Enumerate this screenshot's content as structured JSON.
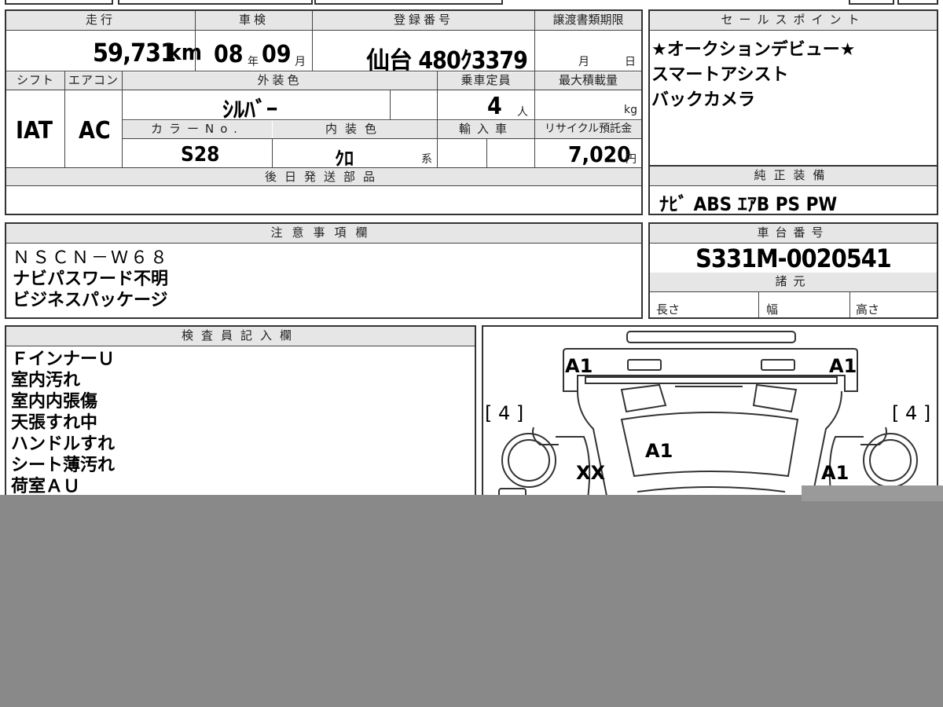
{
  "headers": {
    "mileage": "走行",
    "inspection": "車検",
    "registration": "登録番号",
    "transfer_deadline": "譲渡書類期限",
    "sales_points": "セールスポイント",
    "shift": "シフト",
    "aircon": "エアコン",
    "exterior_color": "外装色",
    "capacity": "乗車定員",
    "max_load": "最大積載量",
    "color_no": "カラーNo.",
    "interior_color": "内装色",
    "import": "輸入車",
    "recycle": "リサイクル預託金",
    "later_parts": "後日発送部品",
    "genuine_equipment": "純正装備",
    "notes": "注意事項欄",
    "chassis_no": "車台番号",
    "specs": "諸元",
    "inspector": "検査員記入欄"
  },
  "vehicle": {
    "mileage": "59,731",
    "mileage_unit": "km",
    "inspection_year": "08",
    "inspection_year_unit": "年",
    "inspection_month": "09",
    "inspection_month_unit": "月",
    "plate": "仙台 480ｸ3379",
    "deadline_month_unit": "月",
    "deadline_day_unit": "日",
    "shift": "IAT",
    "aircon": "AC",
    "exterior_color": "ｼﾙﾊﾞｰ",
    "capacity": "4",
    "capacity_unit": "人",
    "max_load_unit": "kg",
    "color_no": "S28",
    "interior_color": "ｸﾛ",
    "interior_color_unit": "系",
    "recycle_fee": "7,020",
    "recycle_unit": "円",
    "genuine_equipment": "ﾅﾋﾞ ABS ｴｱB PS PW",
    "chassis_no": "S331M-0020541",
    "spec_length": "長さ",
    "spec_width": "幅",
    "spec_height": "高さ"
  },
  "sales_points": [
    "★オークションデビュー★",
    "スマートアシスト",
    "バックカメラ"
  ],
  "notes": [
    "ＮＳＣＮ－Ｗ６８",
    "ナビパスワード不明",
    "ビジネスパッケージ"
  ],
  "inspector_notes": [
    "ＦインナーＵ",
    "室内汚れ",
    "室内内張傷",
    "天張すれ中",
    "ハンドルすれ",
    "シート薄汚れ",
    "荷室ＡＵ"
  ],
  "diagram": {
    "front_left": "A1",
    "front_right": "A1",
    "bracket_left": "[ 4 ]",
    "bracket_right": "[ 4 ]",
    "hood": "A1",
    "left_fender": "XX",
    "right_fender": "A1"
  },
  "colors": {
    "header_bg": "#e6e6e6",
    "border": "#333333",
    "overlay": "#898989"
  }
}
